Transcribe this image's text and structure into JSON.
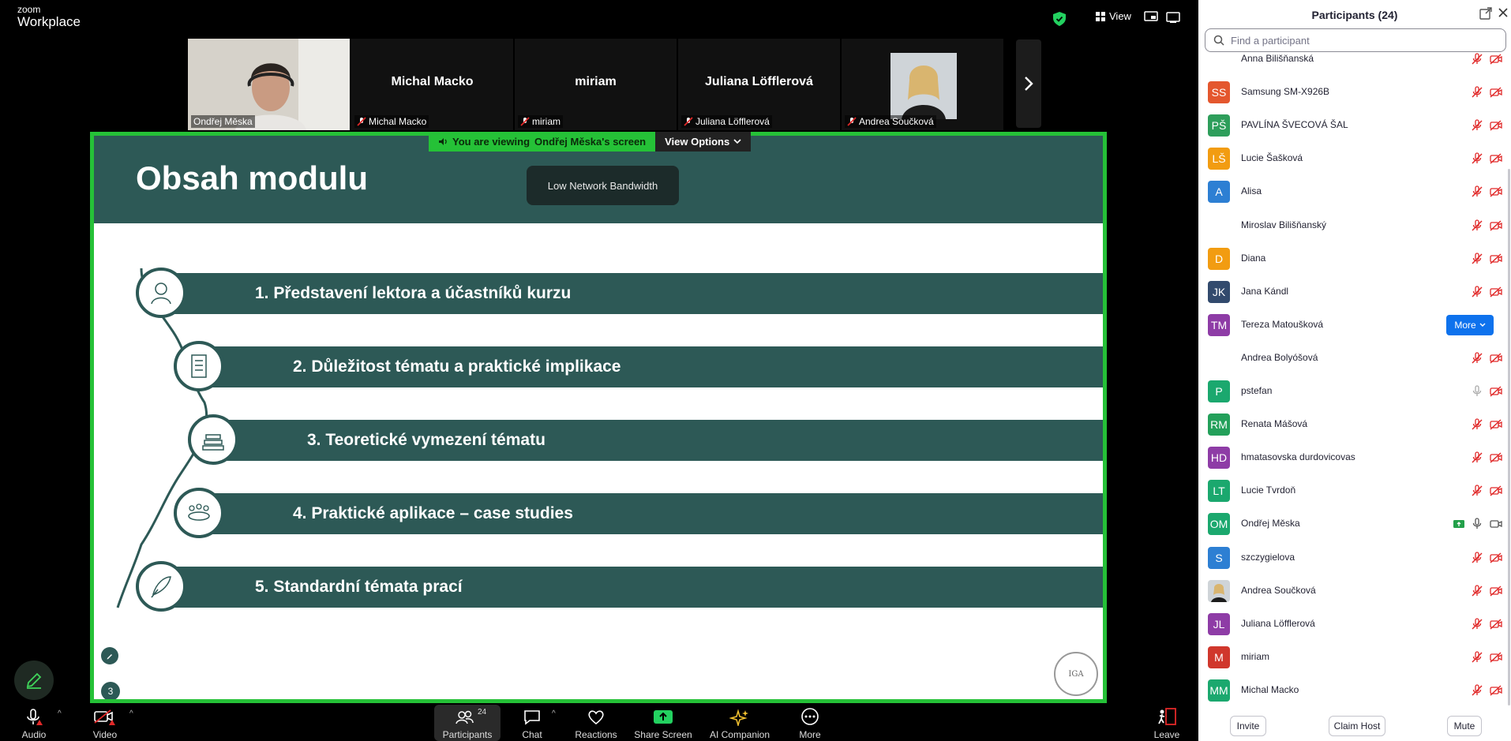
{
  "app": {
    "logo_top": "zoom",
    "logo_bottom": "Workplace",
    "view_label": "View"
  },
  "strip": {
    "tiles": [
      {
        "name": "",
        "label": "Ondřej Měska",
        "muted": false,
        "active": true
      },
      {
        "name": "Michal Macko",
        "label": "Michal Macko",
        "muted": true
      },
      {
        "name": "miriam",
        "label": "miriam",
        "muted": true
      },
      {
        "name": "Juliana Löfflerová",
        "label": "Juliana Löfflerová",
        "muted": true
      },
      {
        "name": "",
        "label": "Andrea Součková",
        "muted": true
      }
    ]
  },
  "share": {
    "viewing_prefix": "You are viewing",
    "viewing_name": "Ondřej Měska's screen",
    "view_options": "View Options",
    "network_badge": "Low Network Bandwidth"
  },
  "slide": {
    "title": "Obsah modulu",
    "items": [
      "1. Představení lektora a účastníků kurzu",
      "2. Důležitost tématu a praktické implikace",
      "3. Teoretické vymezení tématu",
      "4. Praktické aplikace – case studies",
      "5. Standardní témata prací"
    ],
    "page_number": "3",
    "seal_text": "IGA"
  },
  "toolbar": {
    "audio": "Audio",
    "video": "Video",
    "participants": "Participants",
    "participants_count": "24",
    "chat": "Chat",
    "reactions": "Reactions",
    "share_screen": "Share Screen",
    "ai_companion": "AI Companion",
    "more": "More",
    "leave": "Leave"
  },
  "panel": {
    "title": "Participants (24)",
    "search_placeholder": "Find a participant",
    "more_button": "More",
    "participants": [
      {
        "initials": "",
        "name": "Anna Bilišňanská",
        "color": "",
        "mic": "off",
        "video": "off"
      },
      {
        "initials": "SS",
        "name": "Samsung SM-X926B",
        "color": "#e4572e",
        "mic": "off",
        "video": "off"
      },
      {
        "initials": "PŠ",
        "name": "PAVLÍNA ŠVECOVÁ ŠAL",
        "color": "#2e9e5b",
        "mic": "off",
        "video": "off"
      },
      {
        "initials": "LŠ",
        "name": "Lucie Šašková",
        "color": "#f29c11",
        "mic": "off",
        "video": "off"
      },
      {
        "initials": "A",
        "name": "Alisa",
        "color": "#2d7fd3",
        "mic": "off",
        "video": "off"
      },
      {
        "initials": "",
        "name": "Miroslav Bilišňanský",
        "color": "",
        "mic": "off",
        "video": "off"
      },
      {
        "initials": "D",
        "name": "Diana",
        "color": "#f29c11",
        "mic": "off",
        "video": "off"
      },
      {
        "initials": "JK",
        "name": "Jana Kándl",
        "color": "#324a6d",
        "mic": "off",
        "video": "off"
      },
      {
        "initials": "TM",
        "name": "Tereza Matoušková",
        "color": "#8e3ca6",
        "mic": "more",
        "video": "more"
      },
      {
        "initials": "",
        "name": "Andrea Bolyóšová",
        "color": "",
        "mic": "off",
        "video": "off"
      },
      {
        "initials": "P",
        "name": "pstefan",
        "color": "#1ba86e",
        "mic": "on-gray",
        "video": "off"
      },
      {
        "initials": "RM",
        "name": "Renata Mášová",
        "color": "#23a05a",
        "mic": "off",
        "video": "off"
      },
      {
        "initials": "HD",
        "name": "hmatasovska durdovicovas",
        "color": "#8e3ca6",
        "mic": "off",
        "video": "off"
      },
      {
        "initials": "LT",
        "name": "Lucie Tvrdoň",
        "color": "#1ba86e",
        "mic": "off",
        "video": "off"
      },
      {
        "initials": "OM",
        "name": "Ondřej Měska",
        "color": "#1ba86e",
        "mic": "on",
        "video": "on",
        "sharing": true
      },
      {
        "initials": "S",
        "name": "szczygielova",
        "color": "#2d7fd3",
        "mic": "off",
        "video": "off"
      },
      {
        "initials": "",
        "name": "Andrea Součková",
        "color": "",
        "mic": "off",
        "video": "off",
        "photo": true
      },
      {
        "initials": "JL",
        "name": "Juliana Löfflerová",
        "color": "#8e3ca6",
        "mic": "off",
        "video": "off"
      },
      {
        "initials": "M",
        "name": "miriam",
        "color": "#d0372c",
        "mic": "off",
        "video": "off"
      },
      {
        "initials": "MM",
        "name": "Michal Macko",
        "color": "#1ba86e",
        "mic": "off",
        "video": "off"
      }
    ],
    "footer": {
      "invite": "Invite",
      "claim_host": "Claim Host",
      "mute": "Mute"
    }
  },
  "colors": {
    "accent_green": "#25c137",
    "slide_teal": "#2d5956",
    "zoom_blue": "#0e72ed",
    "muted_red": "#e02828"
  }
}
